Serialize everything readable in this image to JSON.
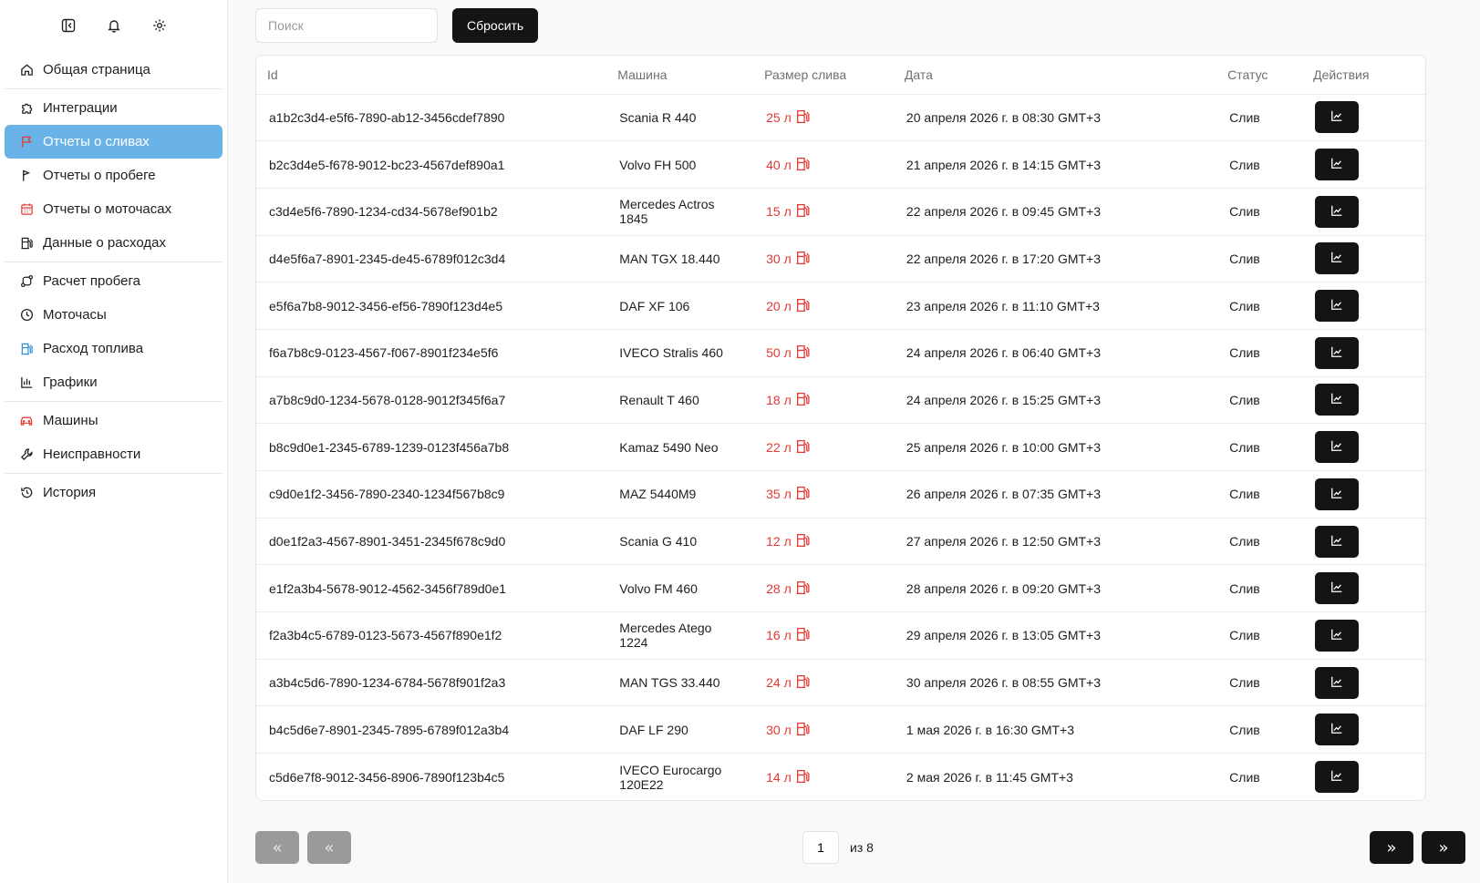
{
  "sidebar": {
    "top_icons": [
      "collapse-sidebar-icon",
      "bell-icon",
      "gear-icon"
    ],
    "groups": [
      {
        "items": [
          {
            "label": "Общая страница",
            "icon": "home-icon"
          }
        ]
      },
      {
        "items": [
          {
            "label": "Интеграции",
            "icon": "puzzle-icon"
          },
          {
            "label": "Отчеты о сливах",
            "icon": "flag-icon",
            "active": true
          },
          {
            "label": "Отчеты о пробеге",
            "icon": "flag-pennant-icon"
          },
          {
            "label": "Отчеты о моточасах",
            "icon": "calendar-icon"
          },
          {
            "label": "Данные о расходах",
            "icon": "fuel-icon"
          }
        ]
      },
      {
        "items": [
          {
            "label": "Расчет пробега",
            "icon": "route-icon"
          },
          {
            "label": "Моточасы",
            "icon": "clock-icon"
          },
          {
            "label": "Расход топлива",
            "icon": "fuel-pump-icon"
          },
          {
            "label": "Графики",
            "icon": "bar-chart-icon"
          }
        ]
      },
      {
        "items": [
          {
            "label": "Машины",
            "icon": "car-icon"
          },
          {
            "label": "Неисправности",
            "icon": "wrench-icon"
          }
        ]
      },
      {
        "items": [
          {
            "label": "История",
            "icon": "history-icon"
          }
        ]
      }
    ]
  },
  "toolbar": {
    "search_placeholder": "Поиск",
    "search_value": "",
    "reset_label": "Сбросить"
  },
  "table": {
    "columns": [
      "Id",
      "Машина",
      "Размер слива",
      "Дата",
      "Статус",
      "Действия"
    ],
    "rows": [
      {
        "id": "a1b2c3d4-e5f6-7890-ab12-3456cdef7890",
        "car": "Scania R 440",
        "size": "25 л",
        "date": "20 апреля 2026 г. в 08:30 GMT+3",
        "status": "Слив"
      },
      {
        "id": "b2c3d4e5-f678-9012-bc23-4567def890a1",
        "car": "Volvo FH 500",
        "size": "40 л",
        "date": "21 апреля 2026 г. в 14:15 GMT+3",
        "status": "Слив"
      },
      {
        "id": "c3d4e5f6-7890-1234-cd34-5678ef901b2",
        "car": "Mercedes Actros 1845",
        "size": "15 л",
        "date": "22 апреля 2026 г. в 09:45 GMT+3",
        "status": "Слив"
      },
      {
        "id": "d4e5f6a7-8901-2345-de45-6789f012c3d4",
        "car": "MAN TGX 18.440",
        "size": "30 л",
        "date": "22 апреля 2026 г. в 17:20 GMT+3",
        "status": "Слив"
      },
      {
        "id": "e5f6a7b8-9012-3456-ef56-7890f123d4e5",
        "car": "DAF XF 106",
        "size": "20 л",
        "date": "23 апреля 2026 г. в 11:10 GMT+3",
        "status": "Слив"
      },
      {
        "id": "f6a7b8c9-0123-4567-f067-8901f234e5f6",
        "car": "IVECO Stralis 460",
        "size": "50 л",
        "date": "24 апреля 2026 г. в 06:40 GMT+3",
        "status": "Слив"
      },
      {
        "id": "a7b8c9d0-1234-5678-0128-9012f345f6a7",
        "car": "Renault T 460",
        "size": "18 л",
        "date": "24 апреля 2026 г. в 15:25 GMT+3",
        "status": "Слив"
      },
      {
        "id": "b8c9d0e1-2345-6789-1239-0123f456a7b8",
        "car": "Kamaz 5490 Neo",
        "size": "22 л",
        "date": "25 апреля 2026 г. в 10:00 GMT+3",
        "status": "Слив"
      },
      {
        "id": "c9d0e1f2-3456-7890-2340-1234f567b8c9",
        "car": "MAZ 5440M9",
        "size": "35 л",
        "date": "26 апреля 2026 г. в 07:35 GMT+3",
        "status": "Слив"
      },
      {
        "id": "d0e1f2a3-4567-8901-3451-2345f678c9d0",
        "car": "Scania G 410",
        "size": "12 л",
        "date": "27 апреля 2026 г. в 12:50 GMT+3",
        "status": "Слив"
      },
      {
        "id": "e1f2a3b4-5678-9012-4562-3456f789d0e1",
        "car": "Volvo FM 460",
        "size": "28 л",
        "date": "28 апреля 2026 г. в 09:20 GMT+3",
        "status": "Слив"
      },
      {
        "id": "f2a3b4c5-6789-0123-5673-4567f890e1f2",
        "car": "Mercedes Atego 1224",
        "size": "16 л",
        "date": "29 апреля 2026 г. в 13:05 GMT+3",
        "status": "Слив"
      },
      {
        "id": "a3b4c5d6-7890-1234-6784-5678f901f2a3",
        "car": "MAN TGS 33.440",
        "size": "24 л",
        "date": "30 апреля 2026 г. в 08:55 GMT+3",
        "status": "Слив"
      },
      {
        "id": "b4c5d6e7-8901-2345-7895-6789f012a3b4",
        "car": "DAF LF 290",
        "size": "30 л",
        "date": "1 мая 2026 г. в 16:30 GMT+3",
        "status": "Слив"
      },
      {
        "id": "c5d6e7f8-9012-3456-8906-7890f123b4c5",
        "car": "IVECO Eurocargo 120E22",
        "size": "14 л",
        "date": "2 мая 2026 г. в 11:45 GMT+3",
        "status": "Слив"
      }
    ],
    "row_action_icon": "line-chart-icon",
    "size_icon": "fuel-pump-icon",
    "size_color": "#e53935"
  },
  "pagination": {
    "first_label": "«",
    "prev_label": "«",
    "next_label": "»",
    "last_label": "»",
    "current_page": "1",
    "total_label": "из 8"
  },
  "colors": {
    "accent": "#6ab3e8",
    "dark_button": "#141414",
    "disabled_button": "#9a9a9a"
  }
}
